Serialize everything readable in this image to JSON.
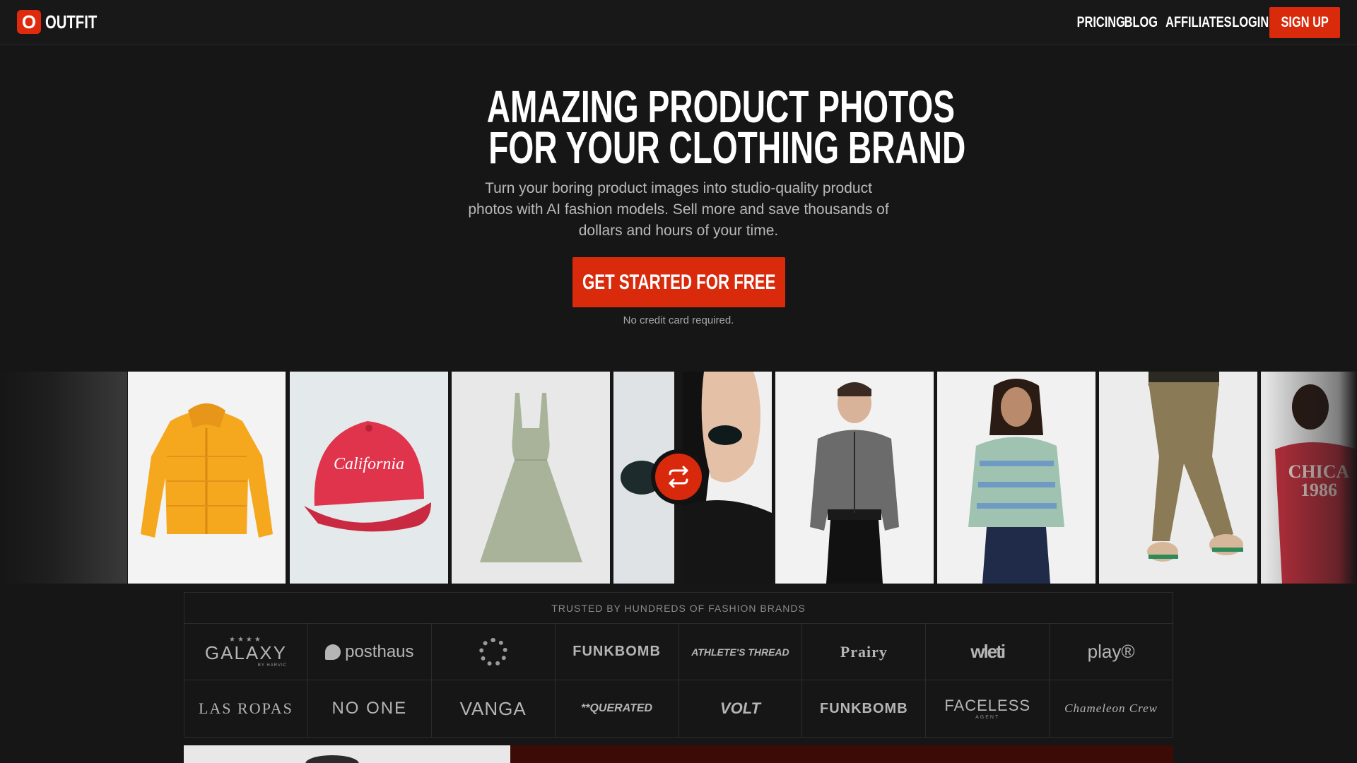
{
  "nav": {
    "logo_mark": "O",
    "logo_text": "OUTFIT",
    "links": [
      "PRICING",
      "BLOG",
      "AFFILIATES",
      "LOGIN"
    ],
    "signup_label": "SIGN UP"
  },
  "hero": {
    "title_line1": "AMAZING PRODUCT PHOTOS",
    "title_line2": "FOR YOUR CLOTHING BRAND",
    "subtitle": "Turn your boring product images into studio-quality product photos with AI fashion models. Sell more and save thousands of dollars and hours of your time.",
    "cta_label": "GET STARTED FOR FREE",
    "note": "No credit card required."
  },
  "gallery": {
    "tile_text": {
      "cap": "California",
      "hoodie": "CHICA\n1986"
    },
    "swap_icon": "swap-arrows-icon",
    "accent_color": "#d9290c"
  },
  "brands": {
    "heading": "TRUSTED BY HUNDREDS OF FASHION BRANDS",
    "row1": [
      "GALAXY",
      "posthaus",
      "",
      "FUNKBOMB",
      "ATHLETE'S THREAD",
      "Prairy",
      "wleti",
      "play®"
    ],
    "row2": [
      "LAS ROPAS",
      "NO ONE",
      "VANGA",
      "**QUERATED",
      "VOLT",
      "FUNKBOMB",
      "FACELESS",
      "Chameleon Crew"
    ],
    "galaxy_sub": "BY HARVIC",
    "faceless_sub": "AGENT"
  }
}
